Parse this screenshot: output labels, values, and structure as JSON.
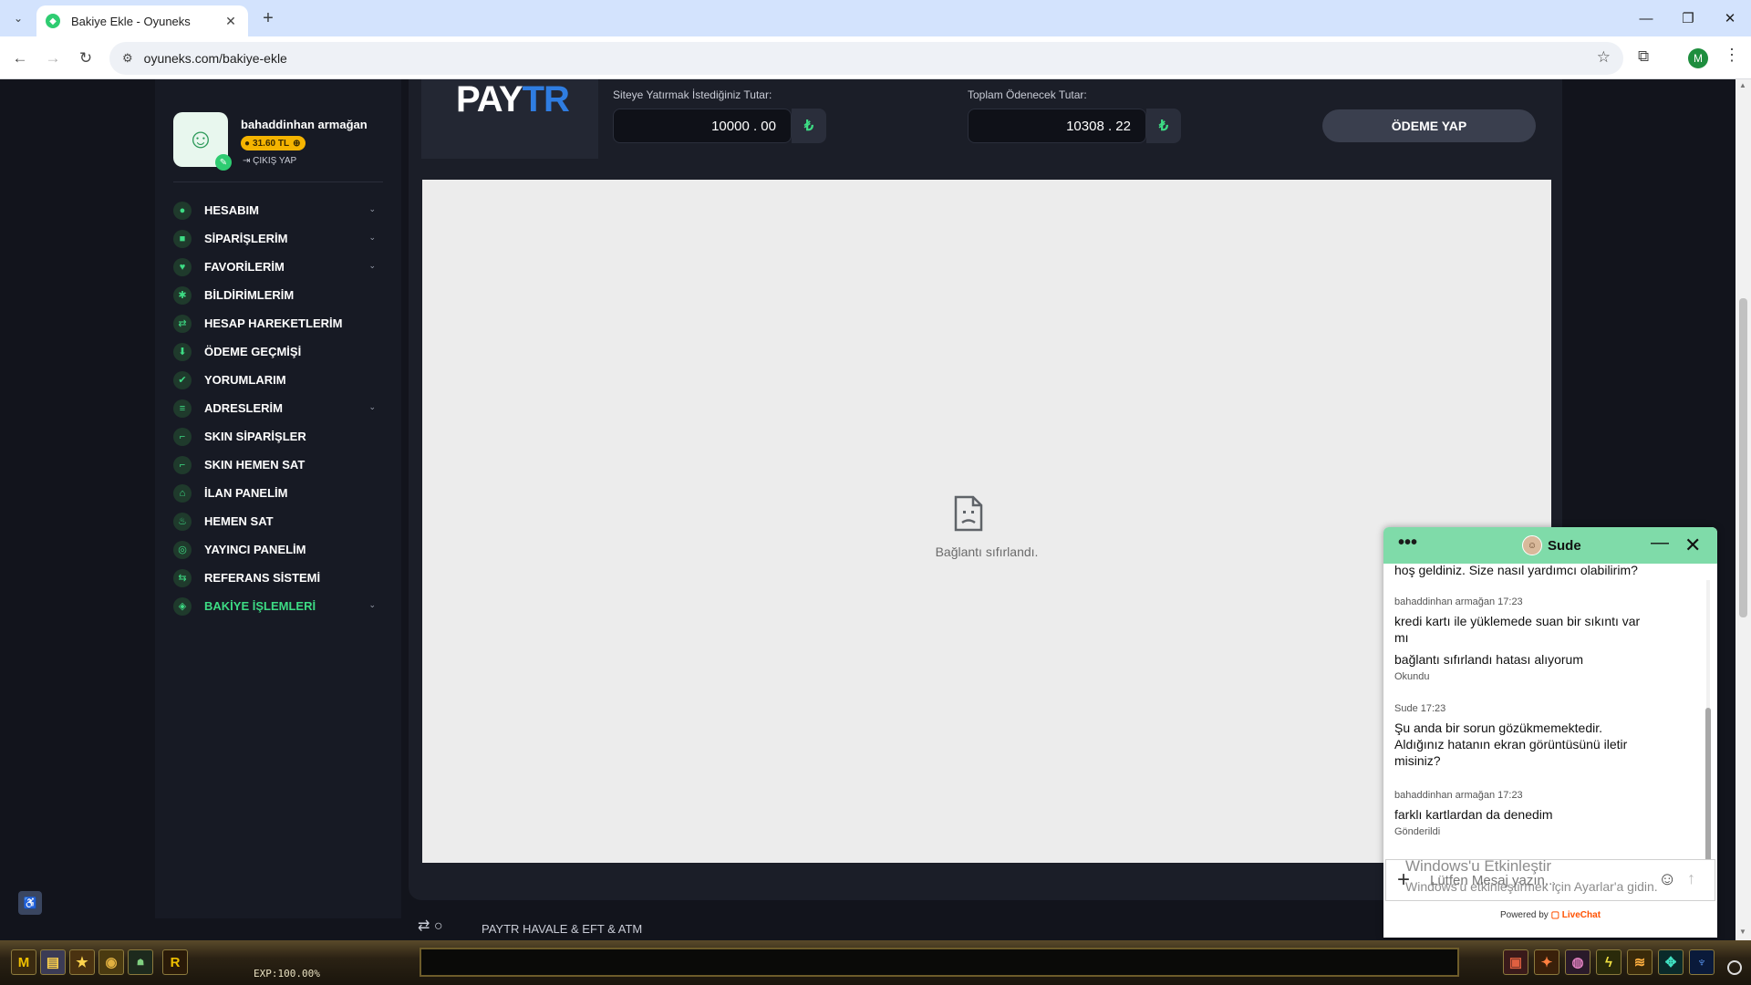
{
  "browser": {
    "tab_title": "Bakiye Ekle - Oyuneks",
    "url": "oyuneks.com/bakiye-ekle",
    "profile_initial": "M"
  },
  "user": {
    "name": "bahaddinhan armağan",
    "balance": "31.60 TL",
    "logout": "ÇIKIŞ YAP"
  },
  "nav": [
    {
      "label": "HESABIM",
      "icon": "user-icon",
      "chevron": true
    },
    {
      "label": "SİPARİŞLERİM",
      "icon": "bag-icon",
      "chevron": true
    },
    {
      "label": "FAVORİLERİM",
      "icon": "heart-icon",
      "chevron": true
    },
    {
      "label": "BİLDİRİMLERİM",
      "icon": "bell-icon",
      "chevron": false
    },
    {
      "label": "HESAP HAREKETLERİM",
      "icon": "transfer-icon",
      "chevron": false
    },
    {
      "label": "ÖDEME GEÇMİŞİ",
      "icon": "payment-icon",
      "chevron": false
    },
    {
      "label": "YORUMLARIM",
      "icon": "comment-icon",
      "chevron": false
    },
    {
      "label": "ADRESLERİM",
      "icon": "address-icon",
      "chevron": true
    },
    {
      "label": "SKIN SİPARİŞLER",
      "icon": "gun-icon",
      "chevron": false
    },
    {
      "label": "SKIN HEMEN SAT",
      "icon": "gun-icon",
      "chevron": false
    },
    {
      "label": "İLAN PANELİM",
      "icon": "store-icon",
      "chevron": false
    },
    {
      "label": "HEMEN SAT",
      "icon": "sell-icon",
      "chevron": false
    },
    {
      "label": "YAYINCI PANELİM",
      "icon": "broadcast-icon",
      "chevron": false
    },
    {
      "label": "REFERANS SİSTEMİ",
      "icon": "referral-icon",
      "chevron": false
    },
    {
      "label": "BAKİYE İŞLEMLERİ",
      "icon": "wallet-icon",
      "chevron": true,
      "active": true
    }
  ],
  "payment": {
    "logo_pay": "PAY",
    "logo_tr": "TR",
    "deposit_label": "Siteye Yatırmak İstediğiniz Tutar:",
    "deposit_value": "10000 . 00",
    "total_label": "Toplam Ödenecek Tutar:",
    "total_value": "10308 . 22",
    "currency_symbol": "₺",
    "pay_button": "ÖDEME YAP",
    "error_text": "Bağlantı sıfırlandı.",
    "next_section": "PAYTR HAVALE & EFT & ATM"
  },
  "chat": {
    "agent": "Sude",
    "greeting_tail": "hoş geldiniz. Size nasıl yardımcı olabilirim?",
    "messages": [
      {
        "meta": "bahaddinhan armağan 17:23",
        "lines": [
          "kredi kartı ile yüklemede suan bir sıkıntı var",
          "mı"
        ],
        "line2": "bağlantı sıfırlandı hatası alıyorum",
        "status": "Okundu"
      },
      {
        "meta": "Sude 17:23",
        "lines": [
          "Şu anda bir sorun gözükmemektedir.",
          "Aldığınız hatanın ekran görüntüsünü iletir",
          "misiniz?"
        ]
      },
      {
        "meta": "bahaddinhan armağan 17:23",
        "lines": [
          "farklı kartlardan da denedim"
        ],
        "status": "Gönderildi"
      }
    ],
    "input_placeholder": "Lütfen Mesaj yazın...",
    "powered_prefix": "Powered by",
    "powered_brand": "LiveChat"
  },
  "os_watermark": {
    "line1": "Windows'u Etkinleştir",
    "line2": "Windows'u etkinleştirmek için Ayarlar'a gidin."
  },
  "gamebar": {
    "exp": "EXP:100.00%"
  }
}
